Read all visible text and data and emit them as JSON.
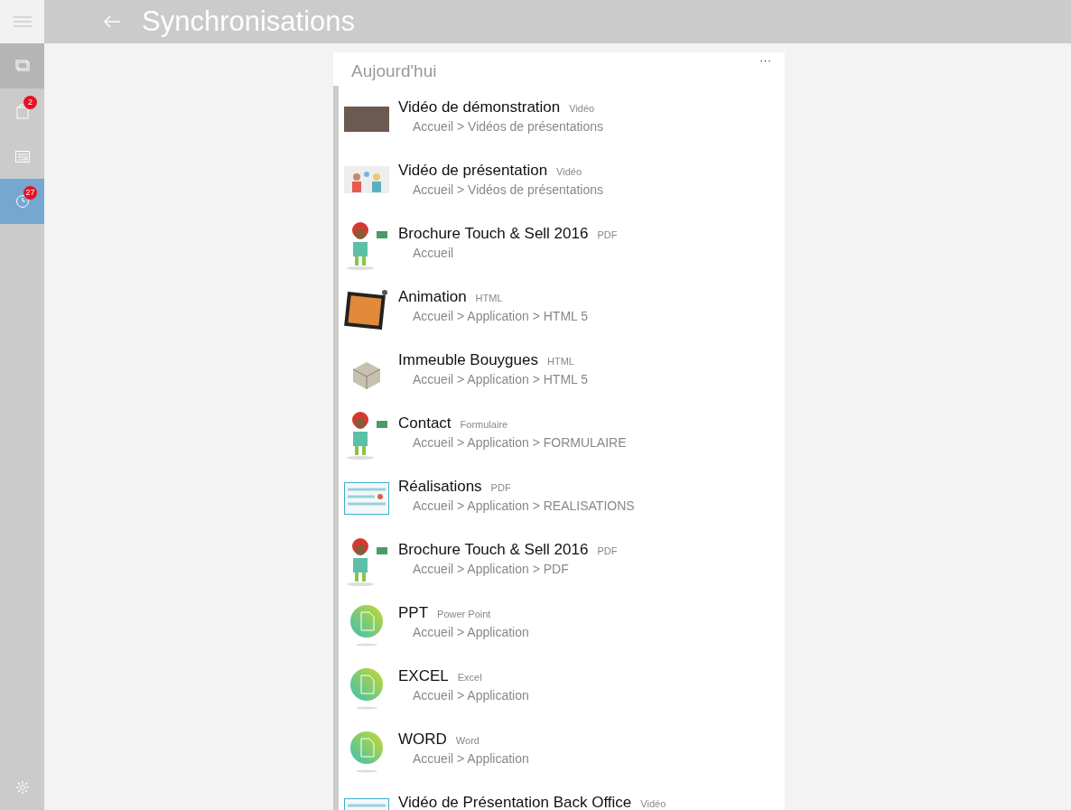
{
  "header": {
    "title": "Synchronisations"
  },
  "sidebar": {
    "items": [
      {
        "kind": "screens",
        "selected": false,
        "hovered": true
      },
      {
        "kind": "bag",
        "badge": "2",
        "selected": false,
        "hovered": false
      },
      {
        "kind": "news",
        "selected": false,
        "hovered": false
      },
      {
        "kind": "clock",
        "badge": "27",
        "selected": true,
        "hovered": false
      }
    ]
  },
  "section": {
    "title": "Aujourd'hui",
    "more": "···"
  },
  "items": [
    {
      "title": "Vidéo de démonstration",
      "type": "Vidéo",
      "path": "Accueil > Vidéos de présentations",
      "kind": "photo"
    },
    {
      "title": "Vidéo de présentation",
      "type": "Vidéo",
      "path": "Accueil > Vidéos de présentations",
      "kind": "people"
    },
    {
      "title": "Brochure Touch & Sell 2016",
      "type": "PDF",
      "path": "Accueil",
      "kind": "mascot"
    },
    {
      "title": "Animation",
      "type": "HTML",
      "path": "Accueil > Application > HTML 5",
      "kind": "tablet"
    },
    {
      "title": "Immeuble Bouygues",
      "type": "HTML",
      "path": "Accueil > Application > HTML 5",
      "kind": "building"
    },
    {
      "title": "Contact",
      "type": "Formulaire",
      "path": "Accueil > Application > FORMULAIRE",
      "kind": "mascot"
    },
    {
      "title": "Réalisations",
      "type": "PDF",
      "path": "Accueil > Application > REALISATIONS",
      "kind": "screenshot"
    },
    {
      "title": "Brochure Touch & Sell 2016",
      "type": "PDF",
      "path": "Accueil > Application > PDF",
      "kind": "mascot"
    },
    {
      "title": "PPT",
      "type": "Power Point",
      "path": "Accueil > Application",
      "kind": "file"
    },
    {
      "title": "EXCEL",
      "type": "Excel",
      "path": "Accueil > Application",
      "kind": "file"
    },
    {
      "title": "WORD",
      "type": "Word",
      "path": "Accueil > Application",
      "kind": "file"
    },
    {
      "title": "Vidéo de Présentation Back Office",
      "type": "Vidéo",
      "kind": "screenshot"
    }
  ]
}
